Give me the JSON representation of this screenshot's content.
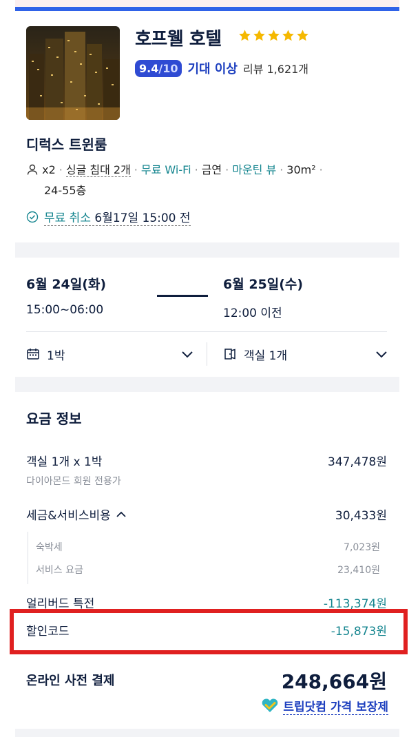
{
  "hotel": {
    "name": "호프웰 호텔",
    "stars": 5,
    "score": "9.4",
    "score_max": "/10",
    "rating_label": "기대 이상",
    "reviews": "리뷰 1,621개"
  },
  "room": {
    "name": "디럭스 트윈룸",
    "guests": "x2",
    "bed": "싱글 침대 2개",
    "wifi": "무료 Wi-Fi",
    "smoking": "금연",
    "view": "마운틴 뷰",
    "size": "30m²",
    "floor": "24-55층"
  },
  "cancellation": {
    "label": "무료 취소",
    "deadline": "6월17일 15:00 전"
  },
  "dates": {
    "checkin_date": "6월 24일(화)",
    "checkin_time": "15:00~06:00",
    "checkout_date": "6월 25일(수)",
    "checkout_time": "12:00 이전",
    "nights": "1박",
    "rooms": "객실 1개"
  },
  "fees": {
    "title": "요금 정보",
    "room_label": "객실 1개 x 1박",
    "room_value": "347,478원",
    "room_note": "다이아몬드 회원 전용가",
    "tax_label": "세금&서비스비용",
    "tax_value": "30,433원",
    "tax_items": [
      {
        "label": "숙박세",
        "value": "7,023원"
      },
      {
        "label": "서비스 요금",
        "value": "23,410원"
      }
    ],
    "early_label": "얼리버드 특전",
    "early_value": "-113,374원",
    "coupon_label": "할인코드",
    "coupon_value": "-15,873원",
    "total_label": "온라인 사전 결제",
    "total_value": "248,664원",
    "guarantee": "트립닷컴 가격 보장제"
  },
  "colors": {
    "accent_blue": "#2f62e8",
    "teal": "#15858f",
    "star": "#f5b800",
    "highlight": "#e02020"
  }
}
